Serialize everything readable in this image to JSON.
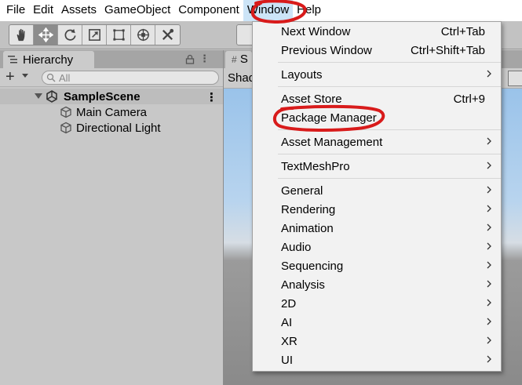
{
  "menubar": {
    "items": [
      "File",
      "Edit",
      "Assets",
      "GameObject",
      "Component",
      "Window",
      "Help"
    ],
    "active_index": 5
  },
  "toolbar": {
    "tools": [
      "hand-tool",
      "move-tool",
      "rotate-tool",
      "scale-tool",
      "rect-tool",
      "transform-tool",
      "custom-editor-tool"
    ],
    "selected_index": 1
  },
  "hierarchy": {
    "tab_label": "Hierarchy",
    "search_placeholder": "All",
    "scene_name": "SampleScene",
    "objects": [
      "Main Camera",
      "Directional Light"
    ]
  },
  "scene_panel": {
    "tab_label": "S",
    "shading_label": "Shad"
  },
  "window_menu": {
    "items": [
      {
        "label": "Next Window",
        "shortcut": "Ctrl+Tab"
      },
      {
        "label": "Previous Window",
        "shortcut": "Ctrl+Shift+Tab"
      },
      {
        "label": "Layouts",
        "submenu": true
      },
      {
        "label": "Asset Store",
        "shortcut": "Ctrl+9"
      },
      {
        "label": "Package Manager"
      },
      {
        "label": "Asset Management",
        "submenu": true
      },
      {
        "label": "TextMeshPro",
        "submenu": true
      },
      {
        "label": "General",
        "submenu": true
      },
      {
        "label": "Rendering",
        "submenu": true
      },
      {
        "label": "Animation",
        "submenu": true
      },
      {
        "label": "Audio",
        "submenu": true
      },
      {
        "label": "Sequencing",
        "submenu": true
      },
      {
        "label": "Analysis",
        "submenu": true
      },
      {
        "label": "2D",
        "submenu": true
      },
      {
        "label": "AI",
        "submenu": true
      },
      {
        "label": "XR",
        "submenu": true
      },
      {
        "label": "UI",
        "submenu": true
      }
    ]
  },
  "colors": {
    "annotation": "#d81b1b",
    "menu_highlight": "#cce4f7",
    "sky": "#9ac3ea"
  }
}
